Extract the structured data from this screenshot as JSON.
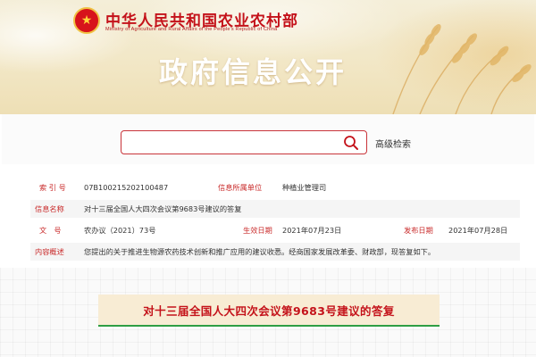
{
  "header": {
    "ministry_name_cn": "中华人民共和国农业农村部",
    "ministry_name_en": "Ministry of Agriculture and Rural Affairs of the People's Republic of China",
    "banner_title": "政府信息公开"
  },
  "search": {
    "placeholder": "",
    "value": "",
    "advanced_label": "高级检索"
  },
  "info": {
    "index_label": "索 引 号",
    "index_value": "07B100215202100487",
    "owner_label": "信息所属单位",
    "owner_value": "种植业管理司",
    "name_label": "信息名称",
    "name_value": "对十三届全国人大四次会议第9683号建议的答复",
    "doc_no_label": "文　号",
    "doc_no_value": "农办议（2021）73号",
    "effective_label": "生效日期",
    "effective_value": "2021年07月23日",
    "publish_label": "发布日期",
    "publish_value": "2021年07月28日",
    "summary_label": "内容概述",
    "summary_value": "您提出的关于推进生物源农药技术创新和推广应用的建议收悉。经商国家发展改革委、财政部，现答复如下。"
  },
  "document": {
    "title": "对十三届全国人大四次会议第9683号建议的答复"
  },
  "icons": {
    "emblem": "national-emblem-icon",
    "search": "search-icon"
  },
  "colors": {
    "brand_red": "#c4121a",
    "label_red": "#c92a2a",
    "accent_green": "#2f9e44"
  }
}
